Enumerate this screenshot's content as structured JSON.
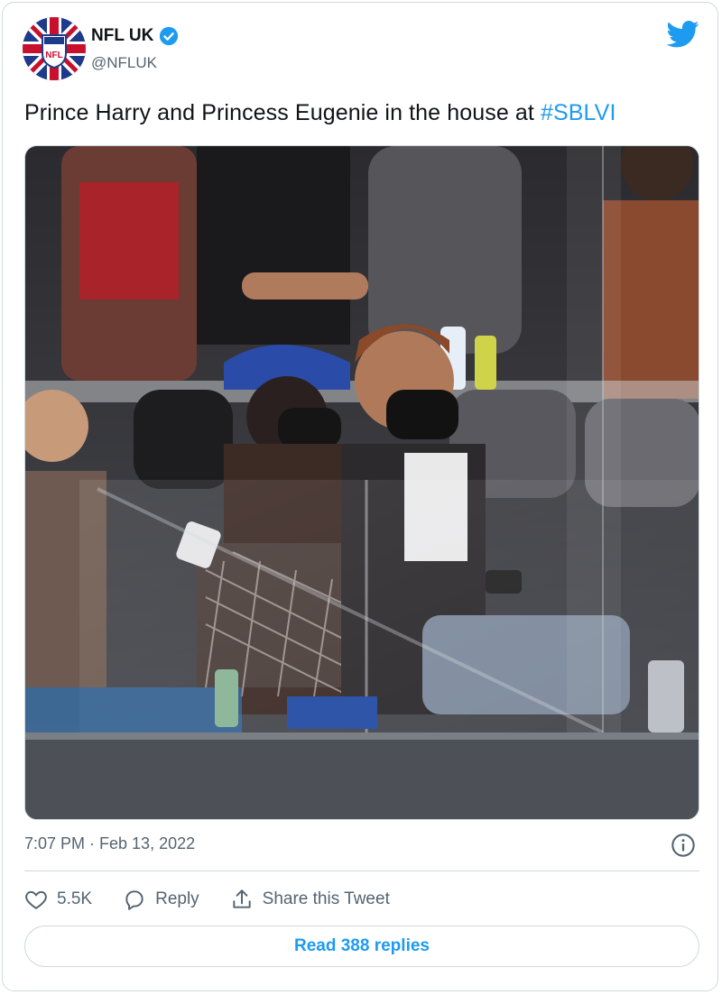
{
  "tweet": {
    "author_name": "NFL UK",
    "author_handle": "@NFLUK",
    "text_prefix": "Prince Harry and Princess Eugenie in the house at ",
    "hashtag": "#SBLVI",
    "timestamp": "7:07 PM · Feb 13, 2022"
  },
  "actions": {
    "like_count": "5.5K",
    "reply_label": "Reply",
    "share_label": "Share this Tweet"
  },
  "read_replies_label": "Read 388 replies",
  "avatar_text": "NFL",
  "icons": {
    "verified": "verified-badge-icon",
    "brand": "twitter-bird-icon",
    "info": "info-icon",
    "like": "heart-icon",
    "reply": "reply-bubble-icon",
    "share": "share-icon"
  },
  "colors": {
    "accent": "#1d9bf0",
    "secondary_text": "#536471",
    "border": "#cfd9de"
  }
}
